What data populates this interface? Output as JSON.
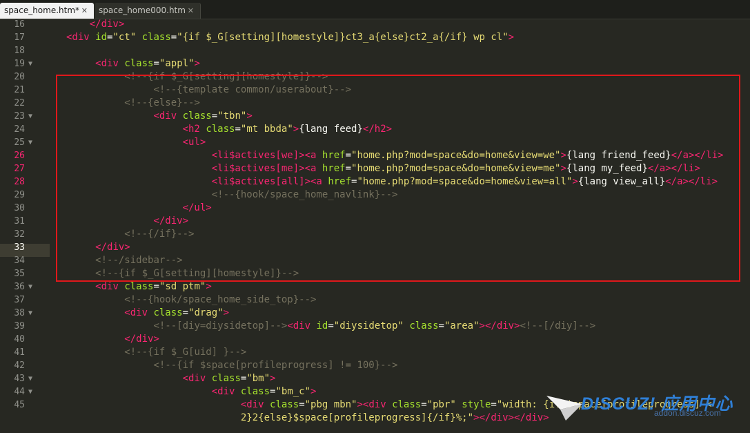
{
  "tabs": [
    {
      "label": "space_home.htm*",
      "close": "✕",
      "active": true
    },
    {
      "label": "space_home000.htm",
      "close": "✕",
      "active": false
    }
  ],
  "editor": {
    "lines": [
      {
        "num": "16",
        "html": "<span class=\"x\">    </span><span class=\"t\">&lt;/div&gt;</span>"
      },
      {
        "num": "17",
        "html": "<span class=\"t\">&lt;div</span> <span class=\"a\">id</span>=<span class=\"s\">\"ct\"</span> <span class=\"a\">class</span>=<span class=\"s\">\"{if $_G[setting][homestyle]}ct3_a{else}ct2_a{/if} wp cl\"</span><span class=\"t\">&gt;</span>"
      },
      {
        "num": "18",
        "html": ""
      },
      {
        "num": "19",
        "fold": "▼",
        "html": "     <span class=\"t\">&lt;div</span> <span class=\"a\">class</span>=<span class=\"s\">\"appl\"</span><span class=\"t\">&gt;</span>"
      },
      {
        "num": "20",
        "html": "          <span class=\"c\">&lt;!--{if $_G[setting][homestyle]}--&gt;</span>"
      },
      {
        "num": "21",
        "html": "               <span class=\"c\">&lt;!--{template common/userabout}--&gt;</span>"
      },
      {
        "num": "22",
        "html": "          <span class=\"c\">&lt;!--{else}--&gt;</span>"
      },
      {
        "num": "23",
        "fold": "▼",
        "html": "               <span class=\"t\">&lt;div</span> <span class=\"a\">class</span>=<span class=\"s\">\"tbn\"</span><span class=\"t\">&gt;</span>"
      },
      {
        "num": "24",
        "html": "                    <span class=\"t\">&lt;h2</span> <span class=\"a\">class</span>=<span class=\"s\">\"mt bbda\"</span><span class=\"t\">&gt;</span>{lang feed}<span class=\"t\">&lt;/h2&gt;</span>"
      },
      {
        "num": "25",
        "fold": "▼",
        "html": "                    <span class=\"t\">&lt;ul&gt;</span>"
      },
      {
        "num": "26",
        "red": true,
        "html": "                         <span class=\"t\">&lt;li$actives[we]&gt;&lt;a</span> <span class=\"a\">href</span>=<span class=\"s\">\"home.php?mod=space&amp;do=home&amp;view=we\"</span><span class=\"t\">&gt;</span>{lang friend_feed}<span class=\"t\">&lt;/a&gt;&lt;/li&gt;</span>"
      },
      {
        "num": "27",
        "red": true,
        "html": "                         <span class=\"t\">&lt;li$actives[me]&gt;&lt;a</span> <span class=\"a\">href</span>=<span class=\"s\">\"home.php?mod=space&amp;do=home&amp;view=me\"</span><span class=\"t\">&gt;</span>{lang my_feed}<span class=\"t\">&lt;/a&gt;&lt;/li&gt;</span>"
      },
      {
        "num": "28",
        "red": true,
        "html": "                         <span class=\"t\">&lt;li$actives[all]&gt;&lt;a</span> <span class=\"a\">href</span>=<span class=\"s\">\"home.php?mod=space&amp;do=home&amp;view=all\"</span><span class=\"t\">&gt;</span>{lang view_all}<span class=\"t\">&lt;/a&gt;&lt;/li&gt;</span>"
      },
      {
        "num": "29",
        "html": "                         <span class=\"c\">&lt;!--{hook/space_home_navlink}--&gt;</span>"
      },
      {
        "num": "30",
        "html": "                    <span class=\"t\">&lt;/ul&gt;</span>"
      },
      {
        "num": "31",
        "html": "               <span class=\"t\">&lt;/div&gt;</span>"
      },
      {
        "num": "32",
        "html": "          <span class=\"c\">&lt;!--{/if}--&gt;</span>"
      },
      {
        "num": "33",
        "current": true,
        "html": "     <span class=\"t\">&lt;/div&gt;</span>"
      },
      {
        "num": "34",
        "html": "     <span class=\"c\">&lt;!--/sidebar--&gt;</span>"
      },
      {
        "num": "35",
        "html": "     <span class=\"c\">&lt;!--{if $_G[setting][homestyle]}--&gt;</span>"
      },
      {
        "num": "36",
        "fold": "▼",
        "html": "     <span class=\"t\">&lt;div</span> <span class=\"a\">class</span>=<span class=\"s\">\"sd ptm\"</span><span class=\"t\">&gt;</span>"
      },
      {
        "num": "37",
        "html": "          <span class=\"c\">&lt;!--{hook/space_home_side_top}--&gt;</span>"
      },
      {
        "num": "38",
        "fold": "▼",
        "html": "          <span class=\"t\">&lt;div</span> <span class=\"a\">class</span>=<span class=\"s\">\"drag\"</span><span class=\"t\">&gt;</span>"
      },
      {
        "num": "39",
        "html": "               <span class=\"c\">&lt;!--[diy=diysidetop]--&gt;</span><span class=\"t\">&lt;div</span> <span class=\"a\">id</span>=<span class=\"s\">\"diysidetop\"</span> <span class=\"a\">class</span>=<span class=\"s\">\"area\"</span><span class=\"t\">&gt;&lt;/div&gt;</span><span class=\"c\">&lt;!--[/diy]--&gt;</span>"
      },
      {
        "num": "40",
        "html": "          <span class=\"t\">&lt;/div&gt;</span>"
      },
      {
        "num": "41",
        "html": "          <span class=\"c\">&lt;!--{if $_G[uid] }--&gt;</span>"
      },
      {
        "num": "42",
        "html": "               <span class=\"c\">&lt;!--{if $space[profileprogress] != 100}--&gt;</span>"
      },
      {
        "num": "43",
        "fold": "▼",
        "html": "                    <span class=\"t\">&lt;div</span> <span class=\"a\">class</span>=<span class=\"s\">\"bm\"</span><span class=\"t\">&gt;</span>"
      },
      {
        "num": "44",
        "fold": "▼",
        "html": "                         <span class=\"t\">&lt;div</span> <span class=\"a\">class</span>=<span class=\"s\">\"bm_c\"</span><span class=\"t\">&gt;</span>"
      },
      {
        "num": "45",
        "html": "                              <span class=\"t\">&lt;div</span> <span class=\"a\">class</span>=<span class=\"s\">\"pbg mbn\"</span><span class=\"t\">&gt;&lt;div</span> <span class=\"a\">class</span>=<span class=\"s\">\"pbr\"</span> <span class=\"a\">style</span>=<span class=\"s\">\"width: {if $space[profileprogress] &lt;</span>"
      },
      {
        "num": "",
        "html": "                              <span class=\"s\">2}2{else}$space[profileprogress]{/if}%;\"</span><span class=\"t\">&gt;&lt;/div&gt;&lt;/div&gt;</span>"
      },
      {
        "num": "",
        "html": ""
      }
    ]
  },
  "watermark": {
    "title": "DISCUZ! 应用中心",
    "subtitle": "addon.discuz.com"
  },
  "colors": {
    "background": "#272822",
    "tag": "#f92672",
    "attribute": "#a6e22e",
    "string": "#e6db74",
    "comment": "#75715e",
    "highlight_box": "#e0181b"
  }
}
